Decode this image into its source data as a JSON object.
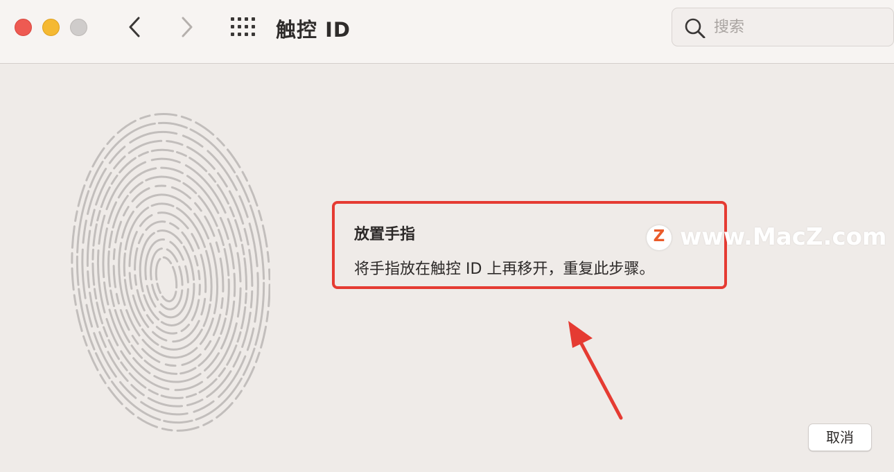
{
  "window": {
    "title": "触控 ID",
    "traffic_lights": {
      "close_color": "#ee5a52",
      "minimize_color": "#f5b932",
      "zoom_color": "#cfcccb"
    }
  },
  "toolbar": {
    "back_icon": "chevron-left",
    "forward_icon": "chevron-right",
    "grid_icon": "show-all-grid",
    "search": {
      "placeholder": "搜索",
      "value": ""
    }
  },
  "main": {
    "fingerprint_icon": "fingerprint",
    "prompt": {
      "title": "放置手指",
      "description": "将手指放在触控 ID 上再移开，重复此步骤。",
      "highlight_color": "#e53b32"
    },
    "watermark": {
      "badge": "Z",
      "text": "www.MacZ.com"
    },
    "annotation_arrow_color": "#e53b32",
    "cancel_label": "取消"
  }
}
